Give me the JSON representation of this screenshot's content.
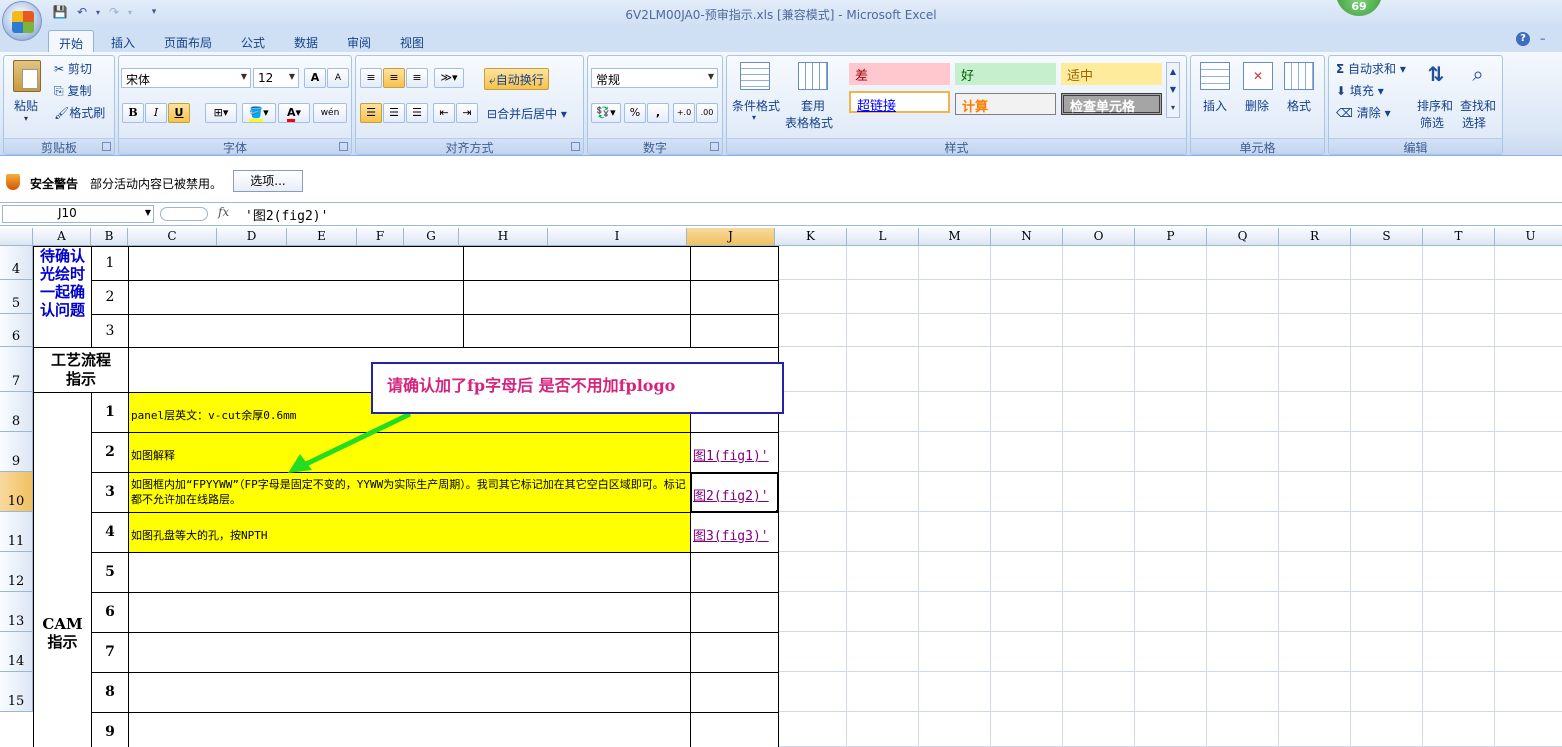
{
  "window": {
    "title": "6V2LM00JA0-预审指示.xls  [兼容模式] - Microsoft Excel",
    "badge": "69"
  },
  "tabs": [
    {
      "label": "开始",
      "active": true
    },
    {
      "label": "插入"
    },
    {
      "label": "页面布局"
    },
    {
      "label": "公式"
    },
    {
      "label": "数据"
    },
    {
      "label": "审阅"
    },
    {
      "label": "视图"
    }
  ],
  "ribbon": {
    "clipboard": {
      "label": "剪贴板",
      "paste": "粘贴",
      "cut": "剪切",
      "copy": "复制",
      "format_painter": "格式刷"
    },
    "font": {
      "label": "字体",
      "name": "宋体",
      "size": "12",
      "bold": "B",
      "italic": "I",
      "underline": "U",
      "grow": "A",
      "shrink": "A",
      "wen": "wén"
    },
    "alignment": {
      "label": "对齐方式",
      "wrap": "自动换行",
      "merge": "合并后居中"
    },
    "number": {
      "label": "数字",
      "format": "常规",
      "percent": "%",
      "comma": ","
    },
    "styles": {
      "label": "样式",
      "cond": "条件格式",
      "table1": "套用",
      "table2": "表格格式",
      "bad": "差",
      "good": "好",
      "neutral": "适中",
      "hyperlink": "超链接",
      "calc": "计算",
      "check": "检查单元格"
    },
    "cells": {
      "label": "单元格",
      "insert": "插入",
      "delete": "删除",
      "format": "格式"
    },
    "editing": {
      "label": "编辑",
      "autosum": "自动求和",
      "fill": "填充",
      "clear": "清除",
      "sort1": "排序和",
      "sort2": "筛选",
      "find1": "查找和",
      "find2": "选择"
    }
  },
  "security": {
    "title": "安全警告",
    "message": "部分活动内容已被禁用。",
    "options": "选项..."
  },
  "formula_bar": {
    "cell": "J10",
    "fx": "fx",
    "formula": "'图2(fig2)'"
  },
  "columns": [
    "A",
    "B",
    "C",
    "D",
    "E",
    "F",
    "G",
    "H",
    "I",
    "J",
    "K",
    "L",
    "M",
    "N",
    "O",
    "P",
    "Q",
    "R",
    "S",
    "T",
    "U"
  ],
  "rows": [
    "4",
    "5",
    "6",
    "7",
    "8",
    "9",
    "10",
    "11",
    "12",
    "13",
    "14",
    "15"
  ],
  "sheet": {
    "a4": "待确认光绘时一起确认问题",
    "b": [
      "1",
      "2",
      "3"
    ],
    "a7": "工艺流程指示",
    "cam_label": "CAM指示",
    "cam_nums": [
      "1",
      "2",
      "3",
      "4",
      "5",
      "6",
      "7",
      "8",
      "9"
    ],
    "c8": "panel层英文：v-cut余厚0.6mm",
    "c9": "如图解释",
    "c10": "如图框内加“FPYYWW”（FP字母是固定不变的，YYWW为实际生产周期）。我司其它标记加在其它空白区域即可。标记都不允许加在线路层。",
    "c11": "如图孔盘等大的孔，按NPTH",
    "j9": "图1(fig1)'",
    "j10": "图2(fig2)'",
    "j11": "图3(fig3)'"
  },
  "callout": {
    "text": "请确认加了fp字母后  是否不用加fplogo"
  }
}
